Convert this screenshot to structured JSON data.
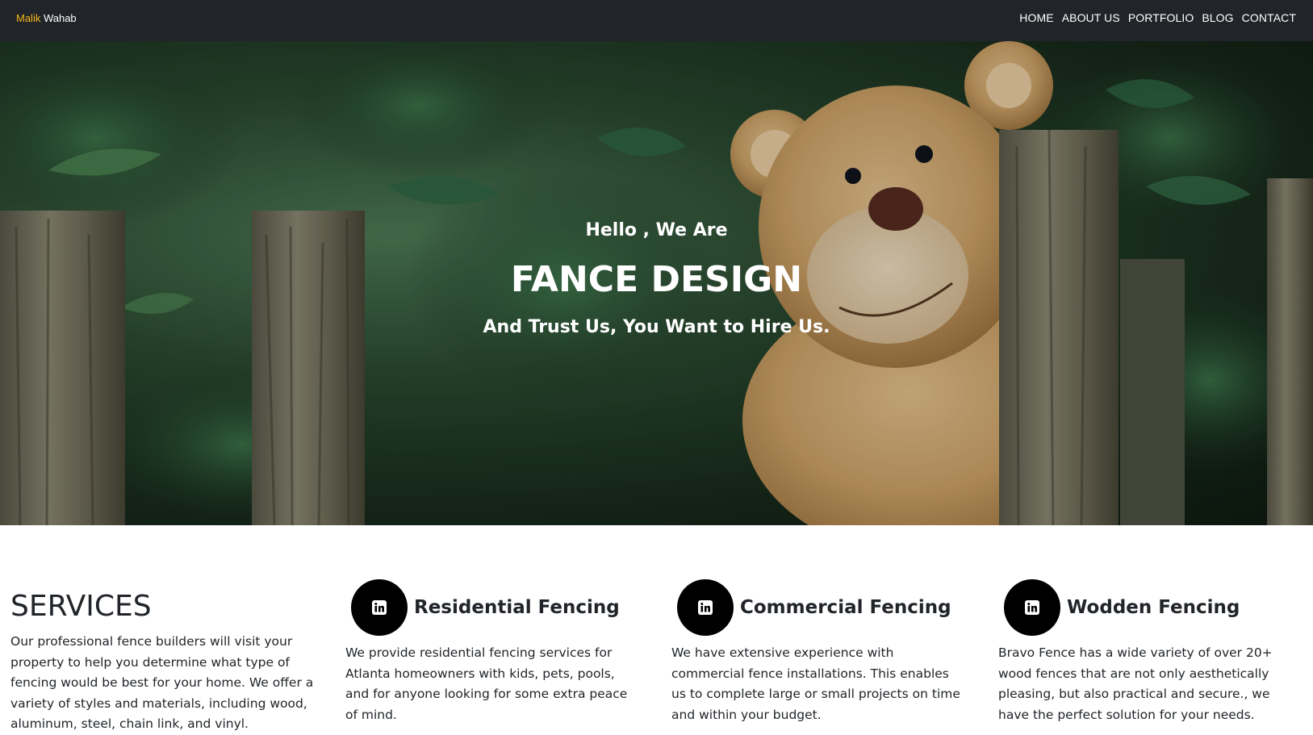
{
  "navbar": {
    "brand_first": "Malik",
    "brand_last": " Wahab",
    "links": [
      "HOME",
      "ABOUT US",
      "PORTFOLIO",
      "BLOG",
      "CONTACT"
    ]
  },
  "hero": {
    "greeting": "Hello , We Are",
    "title": "FANCE DESIGN",
    "subtitle": "And Trust Us, You Want to Hire Us."
  },
  "services": {
    "title": "SERVICES",
    "description": "Our professional fence builders will visit your property to help you determine what type of fencing would be best for your home. We offer a variety of styles and materials, including wood, aluminum, steel, chain link, and vinyl.",
    "items": [
      {
        "icon": "linkedin-icon",
        "name": "Residential Fencing",
        "text": "We provide residential fencing services for Atlanta homeowners with kids, pets, pools, and for anyone looking for some extra peace of mind."
      },
      {
        "icon": "linkedin-icon",
        "name": "Commercial Fencing",
        "text": "We have extensive experience with commercial fence installations. This enables us to complete large or small projects on time and within your budget."
      },
      {
        "icon": "linkedin-icon",
        "name": "Wodden Fencing",
        "text": "Bravo Fence has a wide variety of over 20+ wood fences that are not only aesthetically pleasing, but also practical and secure., we have the perfect solution for your needs."
      }
    ]
  },
  "colors": {
    "navbar_bg": "#212529",
    "brand_accent": "#f5b81c",
    "icon_circle": "#000000"
  }
}
